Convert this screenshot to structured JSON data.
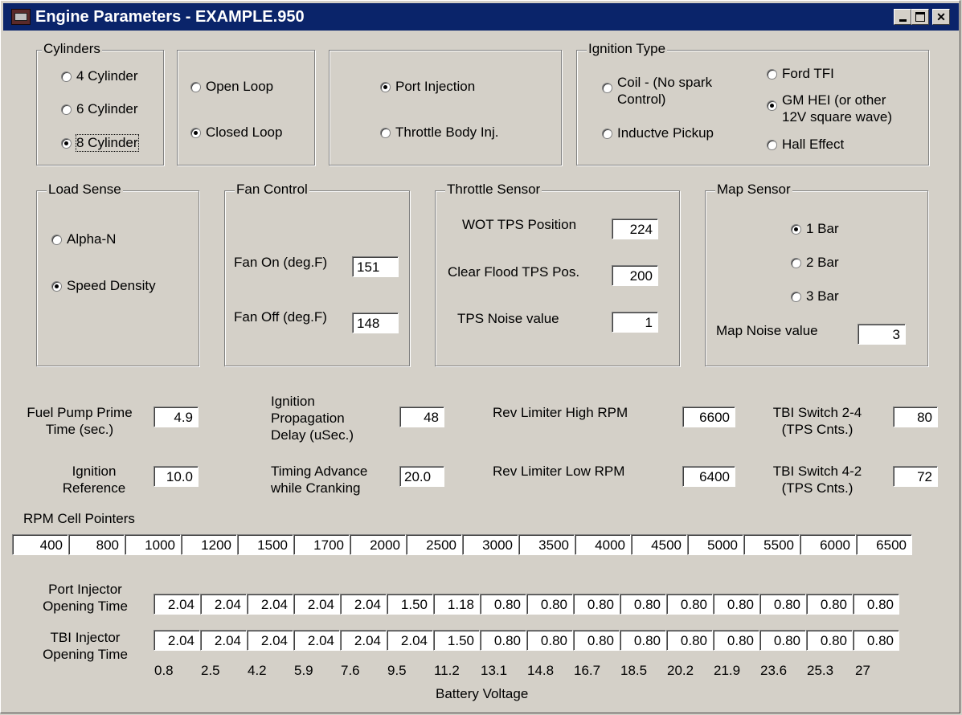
{
  "window": {
    "title": "Engine Parameters - EXAMPLE.950"
  },
  "cylinders": {
    "legend": "Cylinders",
    "options": [
      "4 Cylinder",
      "6 Cylinder",
      "8 Cylinder"
    ],
    "selected": "8 Cylinder"
  },
  "loop": {
    "options": [
      "Open Loop",
      "Closed Loop"
    ],
    "selected": "Closed Loop"
  },
  "injection": {
    "options": [
      "Port Injection",
      "Throttle Body Inj."
    ],
    "selected": "Port Injection"
  },
  "ignition_type": {
    "legend": "Ignition Type",
    "coil_line1": "Coil - (No spark",
    "coil_line2": "Control)",
    "inductive": "Inductve Pickup",
    "ford": "Ford TFI",
    "gm_line1": "GM HEI (or other",
    "gm_line2": "12V square wave)",
    "hall": "Hall Effect",
    "selected": "GM HEI"
  },
  "load_sense": {
    "legend": "Load Sense",
    "options": [
      "Alpha-N",
      "Speed Density"
    ],
    "selected": "Speed Density"
  },
  "fan_control": {
    "legend": "Fan Control",
    "on_label": "Fan On (deg.F)",
    "on_value": "151",
    "off_label": "Fan Off (deg.F)",
    "off_value": "148"
  },
  "throttle_sensor": {
    "legend": "Throttle Sensor",
    "wot_label": "WOT TPS Position",
    "wot_value": "224",
    "flood_label": "Clear Flood TPS Pos.",
    "flood_value": "200",
    "noise_label": "TPS Noise value",
    "noise_value": "1"
  },
  "map_sensor": {
    "legend": "Map Sensor",
    "options": [
      "1 Bar",
      "2 Bar",
      "3 Bar"
    ],
    "selected": "1 Bar",
    "noise_label": "Map Noise value",
    "noise_value": "3"
  },
  "params": {
    "fuel_pump_line1": "Fuel Pump Prime",
    "fuel_pump_line2": "Time (sec.)",
    "fuel_pump_value": "4.9",
    "ign_ref_line1": "Ignition",
    "ign_ref_line2": "Reference",
    "ign_ref_value": "10.0",
    "ign_prop_line1": "Ignition",
    "ign_prop_line2": "Propagation",
    "ign_prop_line3": "Delay (uSec.)",
    "ign_prop_value": "48",
    "timing_line1": "Timing Advance",
    "timing_line2": "while Cranking",
    "timing_value": "20.0",
    "rev_high_label": "Rev Limiter High RPM",
    "rev_high_value": "6600",
    "rev_low_label": "Rev Limiter Low RPM",
    "rev_low_value": "6400",
    "tbi24_line1": "TBI Switch 2-4",
    "tbi24_line2": "(TPS Cnts.)",
    "tbi24_value": "80",
    "tbi42_line1": "TBI Switch 4-2",
    "tbi42_line2": "(TPS Cnts.)",
    "tbi42_value": "72"
  },
  "rpm_cells": {
    "label": "RPM Cell Pointers",
    "values": [
      "400",
      "800",
      "1000",
      "1200",
      "1500",
      "1700",
      "2000",
      "2500",
      "3000",
      "3500",
      "4000",
      "4500",
      "5000",
      "5500",
      "6000",
      "6500"
    ]
  },
  "port_injector": {
    "line1": "Port Injector",
    "line2": "Opening Time",
    "values": [
      "2.04",
      "2.04",
      "2.04",
      "2.04",
      "2.04",
      "1.50",
      "1.18",
      "0.80",
      "0.80",
      "0.80",
      "0.80",
      "0.80",
      "0.80",
      "0.80",
      "0.80",
      "0.80"
    ]
  },
  "tbi_injector": {
    "line1": "TBI Injector",
    "line2": "Opening Time",
    "values": [
      "2.04",
      "2.04",
      "2.04",
      "2.04",
      "2.04",
      "2.04",
      "1.50",
      "0.80",
      "0.80",
      "0.80",
      "0.80",
      "0.80",
      "0.80",
      "0.80",
      "0.80",
      "0.80"
    ]
  },
  "battery_voltage": {
    "label": "Battery Voltage",
    "values": [
      "0.8",
      "2.5",
      "4.2",
      "5.9",
      "7.6",
      "9.5",
      "11.2",
      "13.1",
      "14.8",
      "16.7",
      "18.5",
      "20.2",
      "21.9",
      "23.6",
      "25.3",
      "27"
    ]
  }
}
